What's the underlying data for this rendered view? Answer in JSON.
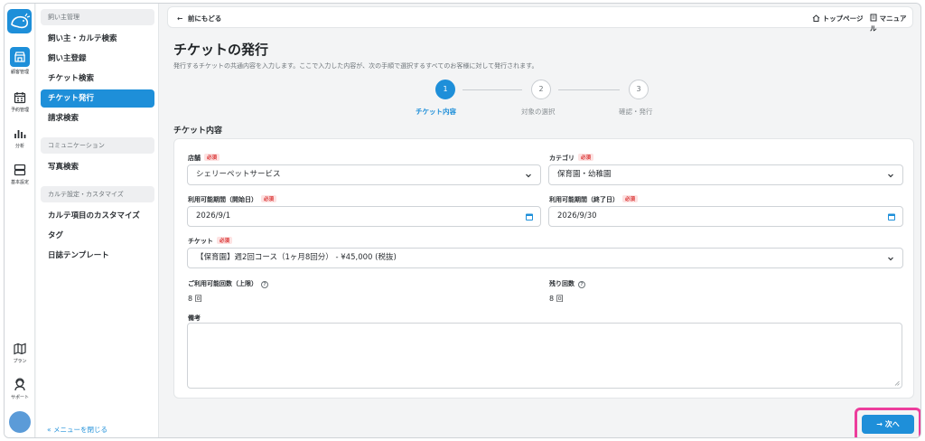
{
  "rail": {
    "items": [
      {
        "label": "顧客管理",
        "icon": "shop-icon"
      },
      {
        "label": "予約管理",
        "icon": "calendar-icon"
      },
      {
        "label": "分析",
        "icon": "bar-chart-icon"
      },
      {
        "label": "基本設定",
        "icon": "storage-icon"
      }
    ],
    "bottom": [
      {
        "label": "プラン",
        "icon": "map-icon"
      },
      {
        "label": "サポート",
        "icon": "support-agent-icon"
      }
    ]
  },
  "menu": {
    "sections": [
      {
        "title": "飼い主管理",
        "items": [
          "飼い主・カルテ検索",
          "飼い主登録",
          "チケット検索",
          "チケット発行",
          "請求検索"
        ]
      },
      {
        "title": "コミュニケーション",
        "items": [
          "写真検索"
        ]
      },
      {
        "title": "カルテ設定・カスタマイズ",
        "items": [
          "カルテ項目のカスタマイズ",
          "タグ",
          "日誌テンプレート"
        ]
      }
    ],
    "collapse_label": "« メニューを閉じる"
  },
  "topbar": {
    "back_label": "前にもどる",
    "top_page_label": "トップページ",
    "manual_label": "マニュアル"
  },
  "page": {
    "title": "チケットの発行",
    "description": "発行するチケットの共通内容を入力します。ここで入力した内容が、次の手順で選択するすべてのお客様に対して発行されます。",
    "section_title": "チケット内容"
  },
  "steps": [
    {
      "num": "1",
      "label": "チケット内容"
    },
    {
      "num": "2",
      "label": "対象の選択"
    },
    {
      "num": "3",
      "label": "確認・発行"
    }
  ],
  "form": {
    "required_tag": "必須",
    "store": {
      "label": "店舗",
      "value": "シェリーペットサービス"
    },
    "category": {
      "label": "カテゴリ",
      "value": "保育園・幼稚園"
    },
    "start": {
      "label": "利用可能期間（開始日）",
      "value": "2026/9/1"
    },
    "end": {
      "label": "利用可能期間（終了日）",
      "value": "2026/9/30"
    },
    "ticket": {
      "label": "チケット",
      "value": "【保育園】週2回コース（1ヶ月8回分） - ¥45,000 (税抜)"
    },
    "limit": {
      "label": "ご利用可能回数（上限）",
      "value": "8 回"
    },
    "remaining": {
      "label": "残り回数",
      "value": "8 回"
    },
    "memo": {
      "label": "備考",
      "value": ""
    }
  },
  "next_label": "→ 次へ",
  "colors": {
    "accent": "#1e8fd9",
    "highlight": "#ec3d9c",
    "required_bg": "#fde2e2",
    "required_text": "#d93030"
  }
}
